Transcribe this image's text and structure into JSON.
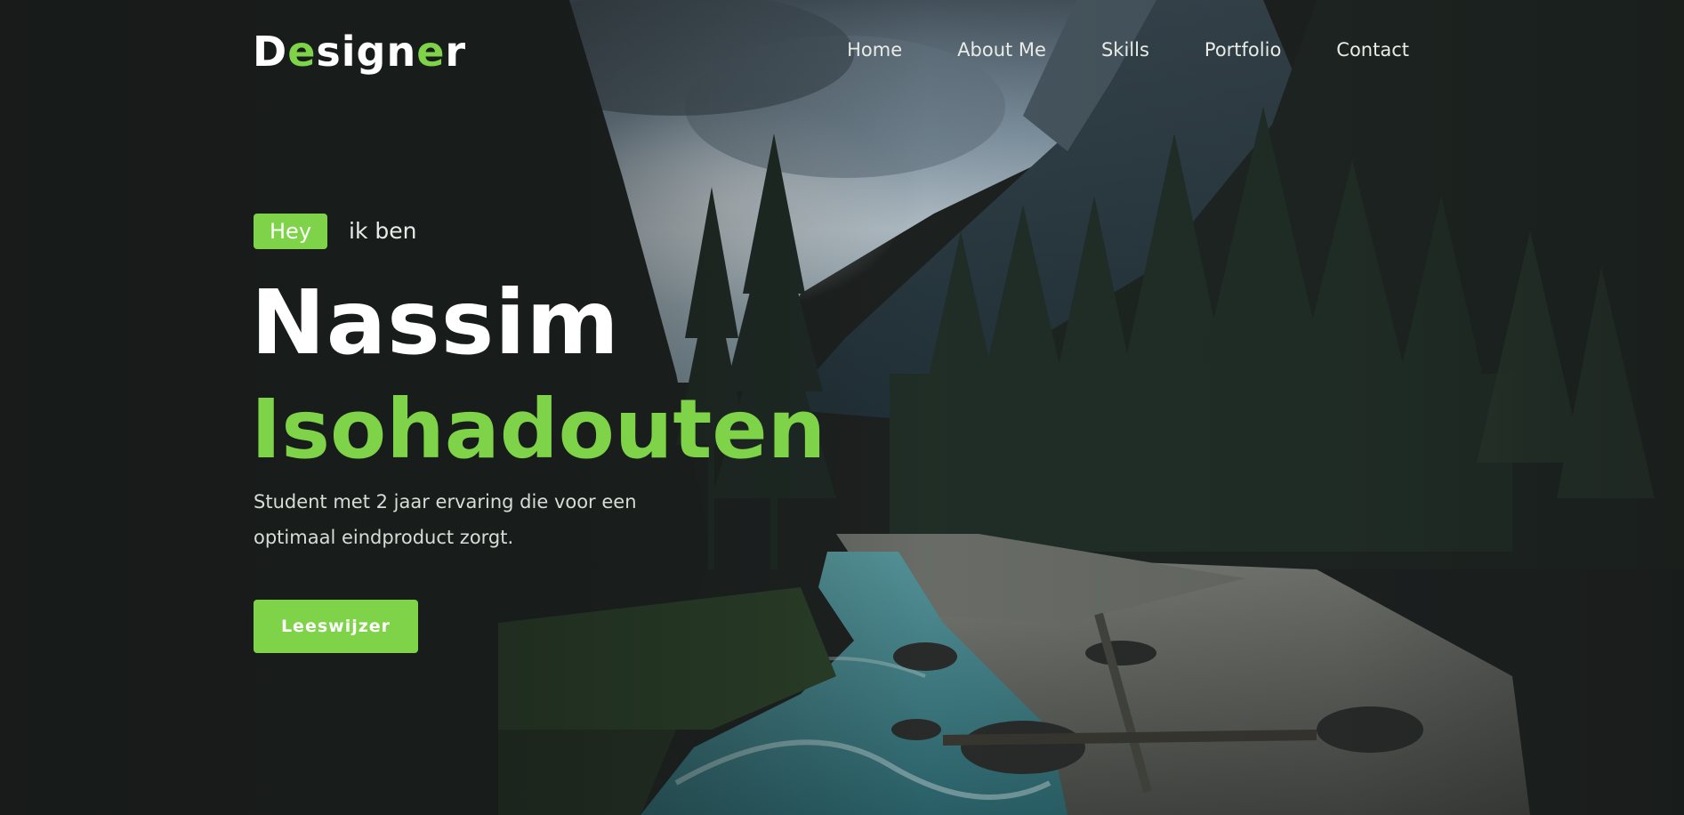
{
  "logo": {
    "parts": [
      "D",
      "e",
      "sign",
      "e",
      "r"
    ]
  },
  "nav": {
    "items": [
      "Home",
      "About Me",
      "Skills",
      "Portfolio",
      "Contact"
    ]
  },
  "hero": {
    "badge": "Hey",
    "intro": "ik ben",
    "first_name": "Nassim",
    "last_name": "Isohadouten",
    "description": "Student met 2 jaar ervaring die voor een optimaal eindproduct zorgt.",
    "cta_label": "Leeswijzer"
  },
  "colors": {
    "accent": "#7ed348",
    "text": "#ffffff",
    "nav_text": "#e8ebe6",
    "background": "#1f2221"
  },
  "background_image": "forest-river-mountain-landscape"
}
